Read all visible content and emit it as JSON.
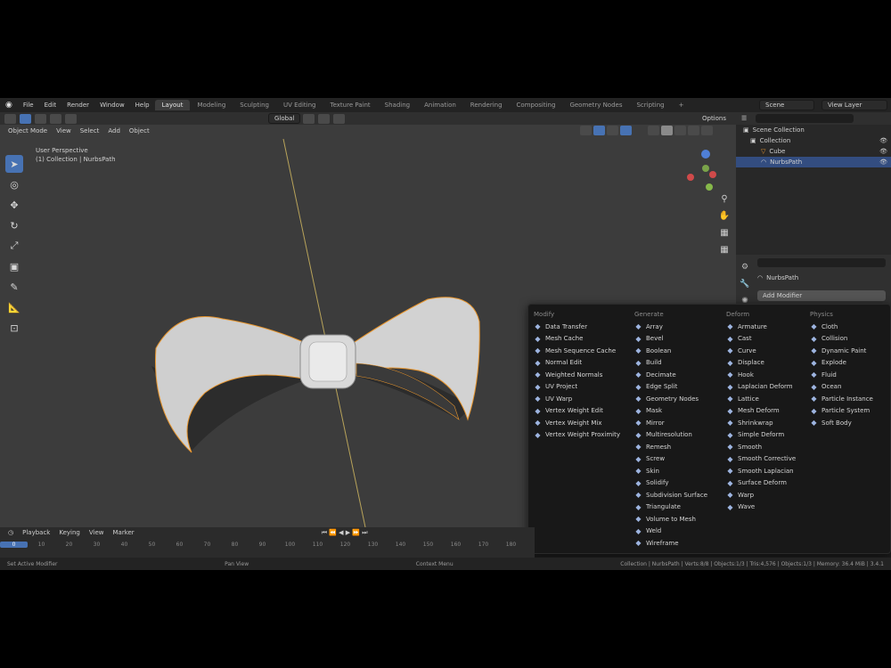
{
  "topbar": {
    "menus": [
      "File",
      "Edit",
      "Render",
      "Window",
      "Help"
    ],
    "tabs": [
      "Layout",
      "Modeling",
      "Sculpting",
      "UV Editing",
      "Texture Paint",
      "Shading",
      "Animation",
      "Rendering",
      "Compositing",
      "Geometry Nodes",
      "Scripting"
    ],
    "active_tab": 0,
    "scene": "Scene",
    "view_layer": "View Layer"
  },
  "viewport": {
    "mode": "Object Mode",
    "menus": [
      "View",
      "Select",
      "Add",
      "Object"
    ],
    "transform": "Global",
    "options": "Options",
    "info_line1": "User Perspective",
    "info_line2": "(1) Collection | NurbsPath"
  },
  "timeline": {
    "menus": [
      "Playback",
      "Keying",
      "View",
      "Marker"
    ],
    "frames": [
      "0",
      "10",
      "20",
      "30",
      "40",
      "50",
      "60",
      "70",
      "80",
      "90",
      "100",
      "110",
      "120",
      "130",
      "140",
      "150",
      "160",
      "170",
      "180"
    ],
    "current_frame": 0
  },
  "statusbar": {
    "left": "Set Active Modifier",
    "mid1": "Pan View",
    "mid2": "Context Menu",
    "right": "Collection | NurbsPath | Verts:8/8 | Objects:1/3 | Tris:4,576 | Objects:1/3 | Memory: 36.4 MiB | 3.4.1"
  },
  "outliner": {
    "rows": [
      "Scene Collection",
      "Collection",
      "Cube",
      "NurbsPath"
    ],
    "selected": 3
  },
  "properties": {
    "object_name": "NurbsPath",
    "add_modifier": "Add Modifier"
  },
  "modifier_menu": {
    "columns": [
      {
        "title": "Modify",
        "items": [
          "Data Transfer",
          "Mesh Cache",
          "Mesh Sequence Cache",
          "Normal Edit",
          "Weighted Normals",
          "UV Project",
          "UV Warp",
          "Vertex Weight Edit",
          "Vertex Weight Mix",
          "Vertex Weight Proximity"
        ]
      },
      {
        "title": "Generate",
        "items": [
          "Array",
          "Bevel",
          "Boolean",
          "Build",
          "Decimate",
          "Edge Split",
          "Geometry Nodes",
          "Mask",
          "Mirror",
          "Multiresolution",
          "Remesh",
          "Screw",
          "Skin",
          "Solidify",
          "Subdivision Surface",
          "Triangulate",
          "Volume to Mesh",
          "Weld",
          "Wireframe"
        ]
      },
      {
        "title": "Deform",
        "items": [
          "Armature",
          "Cast",
          "Curve",
          "Displace",
          "Hook",
          "Laplacian Deform",
          "Lattice",
          "Mesh Deform",
          "Shrinkwrap",
          "Simple Deform",
          "Smooth",
          "Smooth Corrective",
          "Smooth Laplacian",
          "Surface Deform",
          "Warp",
          "Wave"
        ]
      },
      {
        "title": "Physics",
        "items": [
          "Cloth",
          "Collision",
          "Dynamic Paint",
          "Explode",
          "Fluid",
          "Ocean",
          "Particle Instance",
          "Particle System",
          "Soft Body"
        ]
      }
    ]
  },
  "colors": {
    "accent": "#4772b3",
    "selection_outline": "#e8962e",
    "viewport_bg": "#3c3c3c"
  }
}
